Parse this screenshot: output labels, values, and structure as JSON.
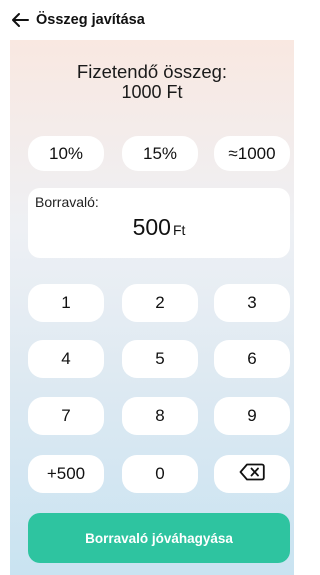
{
  "header": {
    "title": "Összeg javítása",
    "back_icon": "arrow-left-icon"
  },
  "amount": {
    "label": "Fizetendő összeg:",
    "value": "1000 Ft"
  },
  "tip_presets": [
    "10%",
    "15%",
    "≈1000"
  ],
  "tip": {
    "label": "Borravaló:",
    "value": "500",
    "unit": "Ft"
  },
  "keypad": {
    "keys": [
      "1",
      "2",
      "3",
      "4",
      "5",
      "6",
      "7",
      "8",
      "9",
      "+500",
      "0"
    ],
    "backspace_icon": "backspace-icon"
  },
  "confirm_label": "Borravaló jóváhagyása",
  "colors": {
    "accent": "#2ec4a0",
    "panel_top": "#f9e8e1",
    "panel_bottom": "#c9e3f1"
  }
}
